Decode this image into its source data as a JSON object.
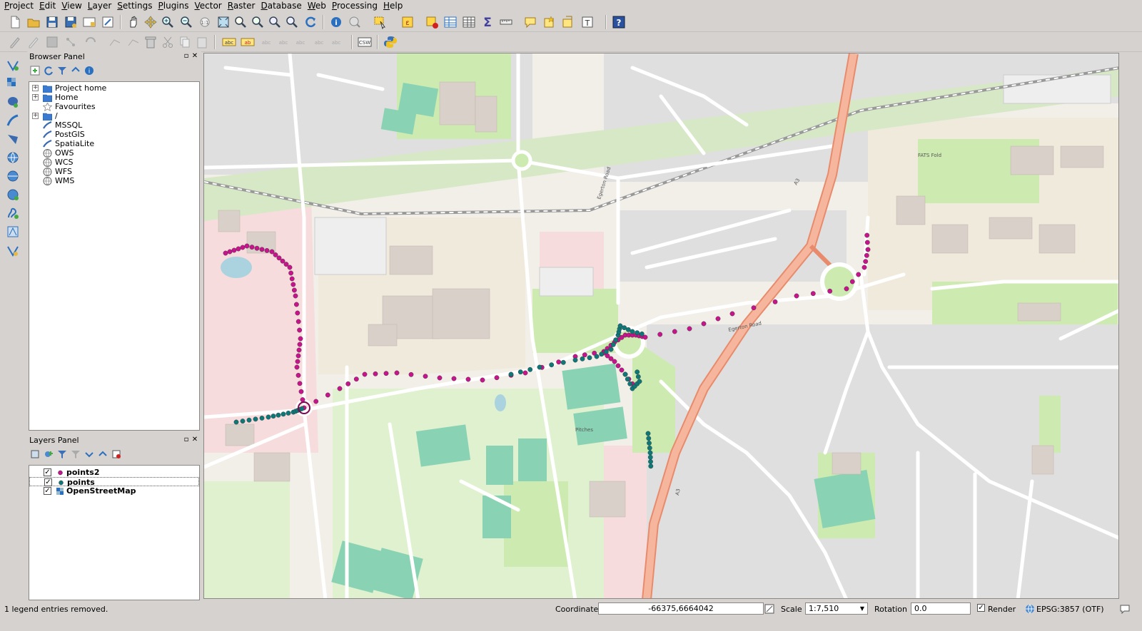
{
  "menubar": [
    "Project",
    "Edit",
    "View",
    "Layer",
    "Settings",
    "Plugins",
    "Vector",
    "Raster",
    "Database",
    "Web",
    "Processing",
    "Help"
  ],
  "browser_panel": {
    "title": "Browser Panel",
    "items": [
      {
        "label": "Project home",
        "icon": "folder-icon",
        "expandable": true
      },
      {
        "label": "Home",
        "icon": "folder-icon",
        "expandable": true
      },
      {
        "label": "Favourites",
        "icon": "star-icon",
        "expandable": false
      },
      {
        "label": "/",
        "icon": "folder-icon",
        "expandable": true
      },
      {
        "label": "MSSQL",
        "icon": "mssql-icon",
        "expandable": false
      },
      {
        "label": "PostGIS",
        "icon": "postgis-icon",
        "expandable": false
      },
      {
        "label": "SpatiaLite",
        "icon": "spatialite-icon",
        "expandable": false
      },
      {
        "label": "OWS",
        "icon": "globe-icon",
        "expandable": false
      },
      {
        "label": "WCS",
        "icon": "globe-icon",
        "expandable": false
      },
      {
        "label": "WFS",
        "icon": "globe-icon",
        "expandable": false
      },
      {
        "label": "WMS",
        "icon": "globe-icon",
        "expandable": false
      }
    ]
  },
  "layers_panel": {
    "title": "Layers Panel",
    "layers": [
      {
        "label": "points2",
        "checked": true,
        "symbol_color": "#c8148c"
      },
      {
        "label": "points",
        "checked": true,
        "symbol_color": "#0e7777"
      },
      {
        "label": "OpenStreetMap",
        "checked": true,
        "symbol_color": "raster"
      }
    ]
  },
  "colors": {
    "points2": "#c8148c",
    "points": "#0e7777",
    "trunk_road": "#f0a080",
    "park": "#c8f0c0",
    "pitch": "#8ad2b4",
    "residential": "#e0dfdf",
    "campus": "#f2efe9",
    "retail": "#f8d8d8"
  },
  "statusbar": {
    "message": "1 legend entries removed.",
    "coordinate_label": "Coordinate",
    "coordinate_value": "-66375,6664042",
    "scale_label": "Scale",
    "scale_value": "1:7,510",
    "rotation_label": "Rotation",
    "rotation_value": "0.0",
    "render_label": "Render",
    "render_checked": true,
    "crs_label": "EPSG:3857 (OTF)"
  }
}
